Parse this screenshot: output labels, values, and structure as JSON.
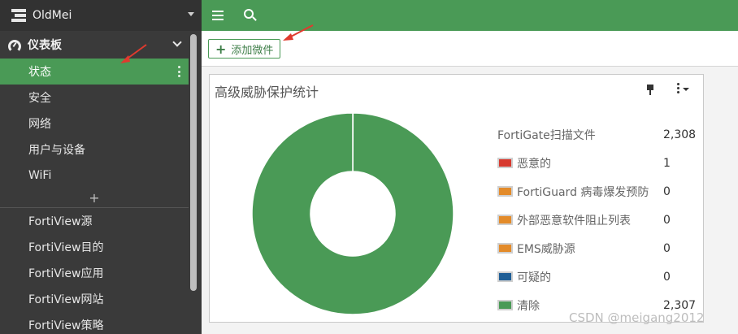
{
  "sidebar": {
    "brand": "OldMei",
    "group_label": "仪表板",
    "items": [
      {
        "label": "状态",
        "active": true
      },
      {
        "label": "安全"
      },
      {
        "label": "网络"
      },
      {
        "label": "用户与设备"
      },
      {
        "label": "WiFi"
      }
    ],
    "add_symbol": "+",
    "fortiview_items": [
      {
        "label": "FortiView源"
      },
      {
        "label": "FortiView目的"
      },
      {
        "label": "FortiView应用"
      },
      {
        "label": "FortiView网站"
      },
      {
        "label": "FortiView策略"
      }
    ]
  },
  "toolbar": {
    "add_widget_label": "添加微件"
  },
  "widget": {
    "title": "高级威胁保护统计",
    "legend": [
      {
        "label": "FortiGate扫描文件",
        "value": "2,308",
        "color": null
      },
      {
        "label": "恶意的",
        "value": "1",
        "color": "#d73a2f"
      },
      {
        "label": "FortiGuard 病毒爆发预防",
        "value": "0",
        "color": "#e38b2a"
      },
      {
        "label": "外部恶意软件阻止列表",
        "value": "0",
        "color": "#e38b2a"
      },
      {
        "label": "EMS威胁源",
        "value": "0",
        "color": "#e38b2a"
      },
      {
        "label": "可疑的",
        "value": "0",
        "color": "#1f5e96"
      },
      {
        "label": "清除",
        "value": "2,307",
        "color": "#4a9a56"
      }
    ]
  },
  "chart_data": {
    "type": "pie",
    "categories": [
      "恶意的",
      "FortiGuard 病毒爆发预防",
      "外部恶意软件阻止列表",
      "EMS威胁源",
      "可疑的",
      "清除"
    ],
    "values": [
      1,
      0,
      0,
      0,
      0,
      2307
    ],
    "colors": [
      "#d73a2f",
      "#e38b2a",
      "#e38b2a",
      "#e38b2a",
      "#1f5e96",
      "#4a9a56"
    ],
    "title": "高级威胁保护统计"
  },
  "watermark": "CSDN @meigang2012",
  "colors": {
    "accent": "#4a9a56",
    "sidebar": "#3a3a3a"
  }
}
